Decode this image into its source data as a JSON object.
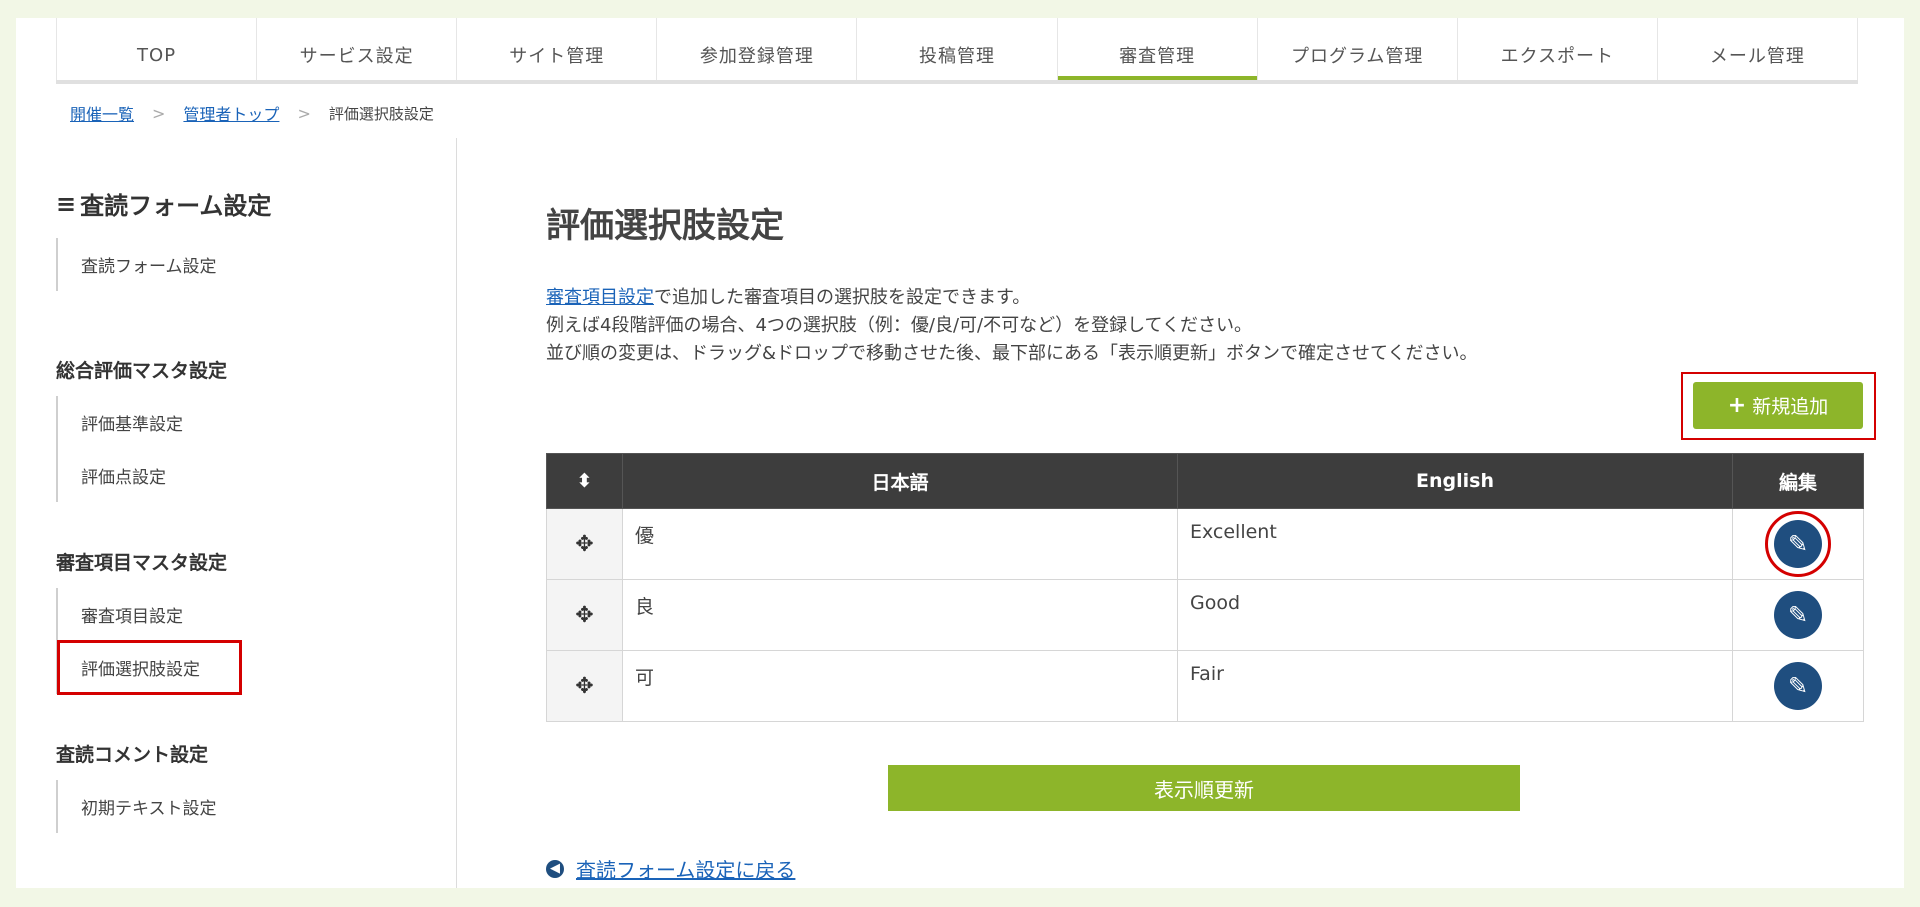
{
  "nav": {
    "tabs": [
      {
        "label": "TOP"
      },
      {
        "label": "サービス設定"
      },
      {
        "label": "サイト管理"
      },
      {
        "label": "参加登録管理"
      },
      {
        "label": "投稿管理"
      },
      {
        "label": "審査管理"
      },
      {
        "label": "プログラム管理"
      },
      {
        "label": "エクスポート"
      },
      {
        "label": "メール管理"
      }
    ],
    "active_tab": "審査管理"
  },
  "breadcrumb": {
    "items": [
      "開催一覧",
      "管理者トップ"
    ],
    "current": "評価選択肢設定",
    "separator": ">"
  },
  "sidebar": {
    "title_icon": "≡",
    "title": "査読フォーム設定",
    "item_form": "査読フォーム設定",
    "group_overall": "総合評価マスタ設定",
    "item_criteria": "評価基準設定",
    "item_points": "評価点設定",
    "group_review": "審査項目マスタ設定",
    "item_review_items": "審査項目設定",
    "item_choices": "評価選択肢設定",
    "group_comment": "査読コメント設定",
    "item_initial_text": "初期テキスト設定"
  },
  "main": {
    "title": "評価選択肢設定",
    "desc_link": "審査項目設定",
    "desc_line1_rest": "で追加した審査項目の選択肢を設定できます。",
    "desc_line2": "例えば4段階評価の場合、4つの選択肢（例：優/良/可/不可など）を登録してください。",
    "desc_line3": "並び順の変更は、ドラッグ&ドロップで移動させた後、最下部にある「表示順更新」ボタンで確定させてください。",
    "add_button": "新規追加",
    "table": {
      "sort_icon": "⬍",
      "col_ja": "日本語",
      "col_en": "English",
      "col_edit": "編集",
      "rows": [
        {
          "ja": "優",
          "en": "Excellent"
        },
        {
          "ja": "良",
          "en": "Good"
        },
        {
          "ja": "可",
          "en": "Fair"
        }
      ]
    },
    "update_button": "表示順更新",
    "back_link": "査読フォーム設定に戻る"
  },
  "colors": {
    "accent_green": "#8db52a",
    "edit_blue": "#1f4e7f",
    "highlight_red": "#d40000",
    "link_blue": "#1a63b8"
  },
  "icons": {
    "drag": "move-arrows-icon",
    "edit": "pencil-icon",
    "back": "circle-arrow-left-icon",
    "add": "plus-icon"
  }
}
